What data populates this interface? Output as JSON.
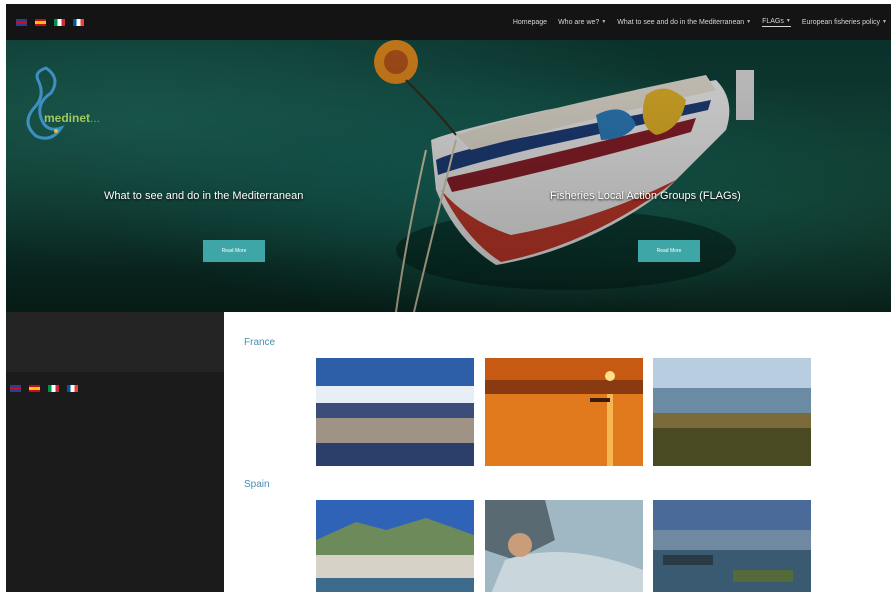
{
  "flags": [
    "uk-flag-icon",
    "spain-flag-icon",
    "italy-flag-icon",
    "france-flag-icon"
  ],
  "nav": {
    "items": [
      {
        "label": "Homepage",
        "dropdown": false,
        "active": false
      },
      {
        "label": "Who are we?",
        "dropdown": true,
        "active": false
      },
      {
        "label": "What to see and do in the Mediterranean",
        "dropdown": true,
        "active": false
      },
      {
        "label": "FLAGs",
        "dropdown": true,
        "active": true
      },
      {
        "label": "European fisheries policy",
        "dropdown": true,
        "active": false
      }
    ]
  },
  "logo": {
    "text_a": "medinet",
    "text_b": "..."
  },
  "hero": {
    "slides": [
      {
        "caption": "What to see and do in the Mediterranean",
        "button": "Read More"
      },
      {
        "caption": "Fisheries Local Action Groups (FLAGs)",
        "button": "Read More"
      }
    ]
  },
  "sections": [
    {
      "title": "France",
      "photos": [
        "harbour-town-photo",
        "sunset-sea-photo",
        "coastal-lagoon-photo"
      ]
    },
    {
      "title": "Spain",
      "photos": [
        "seaside-town-photo",
        "fisherman-net-photo",
        "port-boats-photo"
      ]
    }
  ],
  "colors": {
    "accent": "#3fa6a8",
    "nav_bg": "#141414",
    "section_title": "#4a8fb0"
  }
}
